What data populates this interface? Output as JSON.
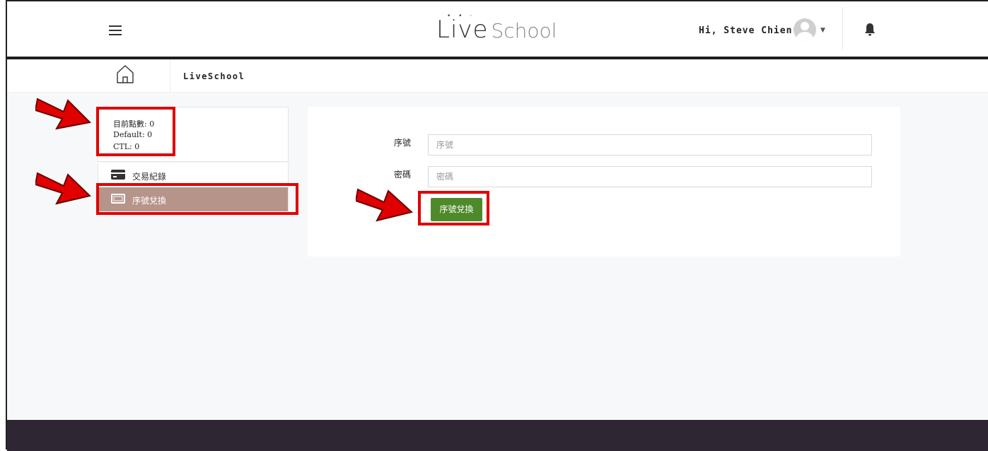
{
  "header": {
    "logo_main": "Live",
    "logo_sub": "School",
    "greeting": "Hi, Steve Chien"
  },
  "breadcrumb": {
    "title": "LiveSchool"
  },
  "points": {
    "current": "目前點數: 0",
    "default": "Default: 0",
    "ctl": "CTL: 0"
  },
  "sidebar": {
    "items": [
      {
        "label": "交易紀錄",
        "icon": "credit-card-icon"
      },
      {
        "label": "序號兌換",
        "icon": "ticket-icon",
        "active": true
      }
    ]
  },
  "form": {
    "serial_label": "序號",
    "serial_placeholder": "序號",
    "password_label": "密碼",
    "password_placeholder": "密碼",
    "submit_label": "序號兌換"
  },
  "colors": {
    "active_menu": "#b7948a",
    "submit_button": "#4e8a2a",
    "footer": "#2f2633",
    "highlight": "#e00000"
  }
}
